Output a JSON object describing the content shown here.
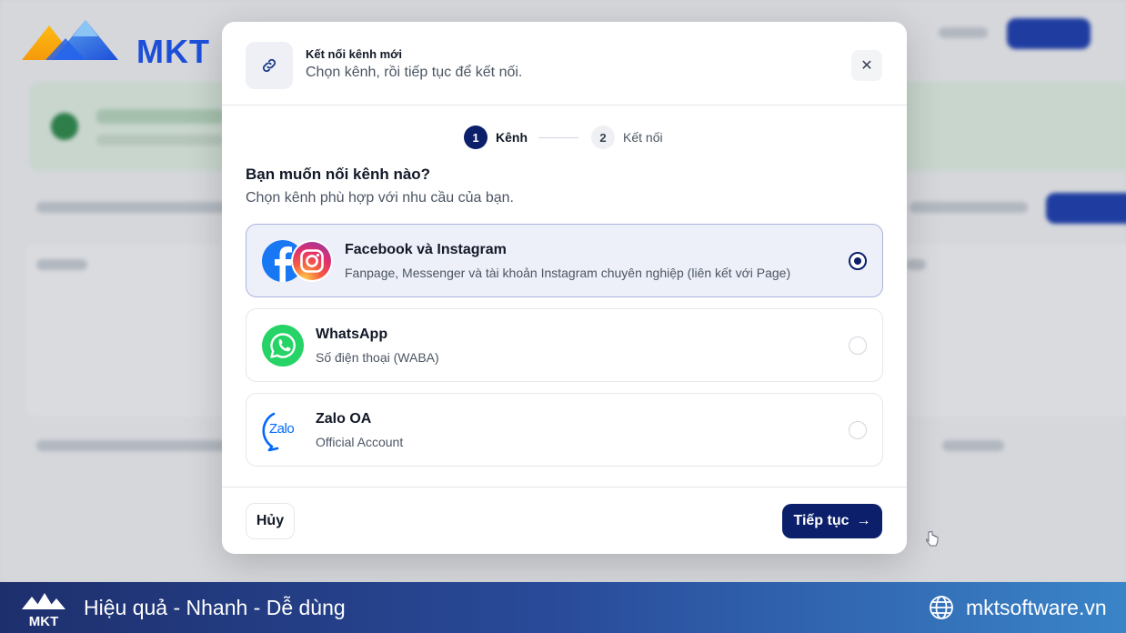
{
  "brand": {
    "logo_text": "MKT",
    "slogan": "Hiệu quả - Nhanh - Dễ dùng",
    "website": "mktsoftware.vn"
  },
  "modal": {
    "title": "Kết nối kênh mới",
    "subtitle": "Chọn kênh, rồi tiếp tục để kết nối.",
    "close_symbol": "✕",
    "steps": [
      {
        "number": "1",
        "label": "Kênh",
        "active": true
      },
      {
        "number": "2",
        "label": "Kết nối",
        "active": false
      }
    ],
    "question_title": "Bạn muốn nối kênh nào?",
    "question_subtitle": "Chọn kênh phù hợp với nhu cầu của bạn.",
    "options": [
      {
        "title": "Facebook và Instagram",
        "description": "Fanpage, Messenger và tài khoản Instagram chuyên nghiệp (liên kết với Page)",
        "selected": true,
        "icon": "facebook-instagram-icon"
      },
      {
        "title": "WhatsApp",
        "description": "Số điện thoại (WABA)",
        "selected": false,
        "icon": "whatsapp-icon"
      },
      {
        "title": "Zalo OA",
        "description": "Official Account",
        "selected": false,
        "icon": "zalo-icon"
      }
    ],
    "zalo_icon_text": "Zalo",
    "cancel_label": "Hủy",
    "next_label": "Tiếp tục",
    "next_arrow": "→"
  },
  "colors": {
    "primary": "#0b1f6b",
    "facebook": "#1877f2",
    "whatsapp": "#25d366",
    "zalo": "#0068ff"
  }
}
